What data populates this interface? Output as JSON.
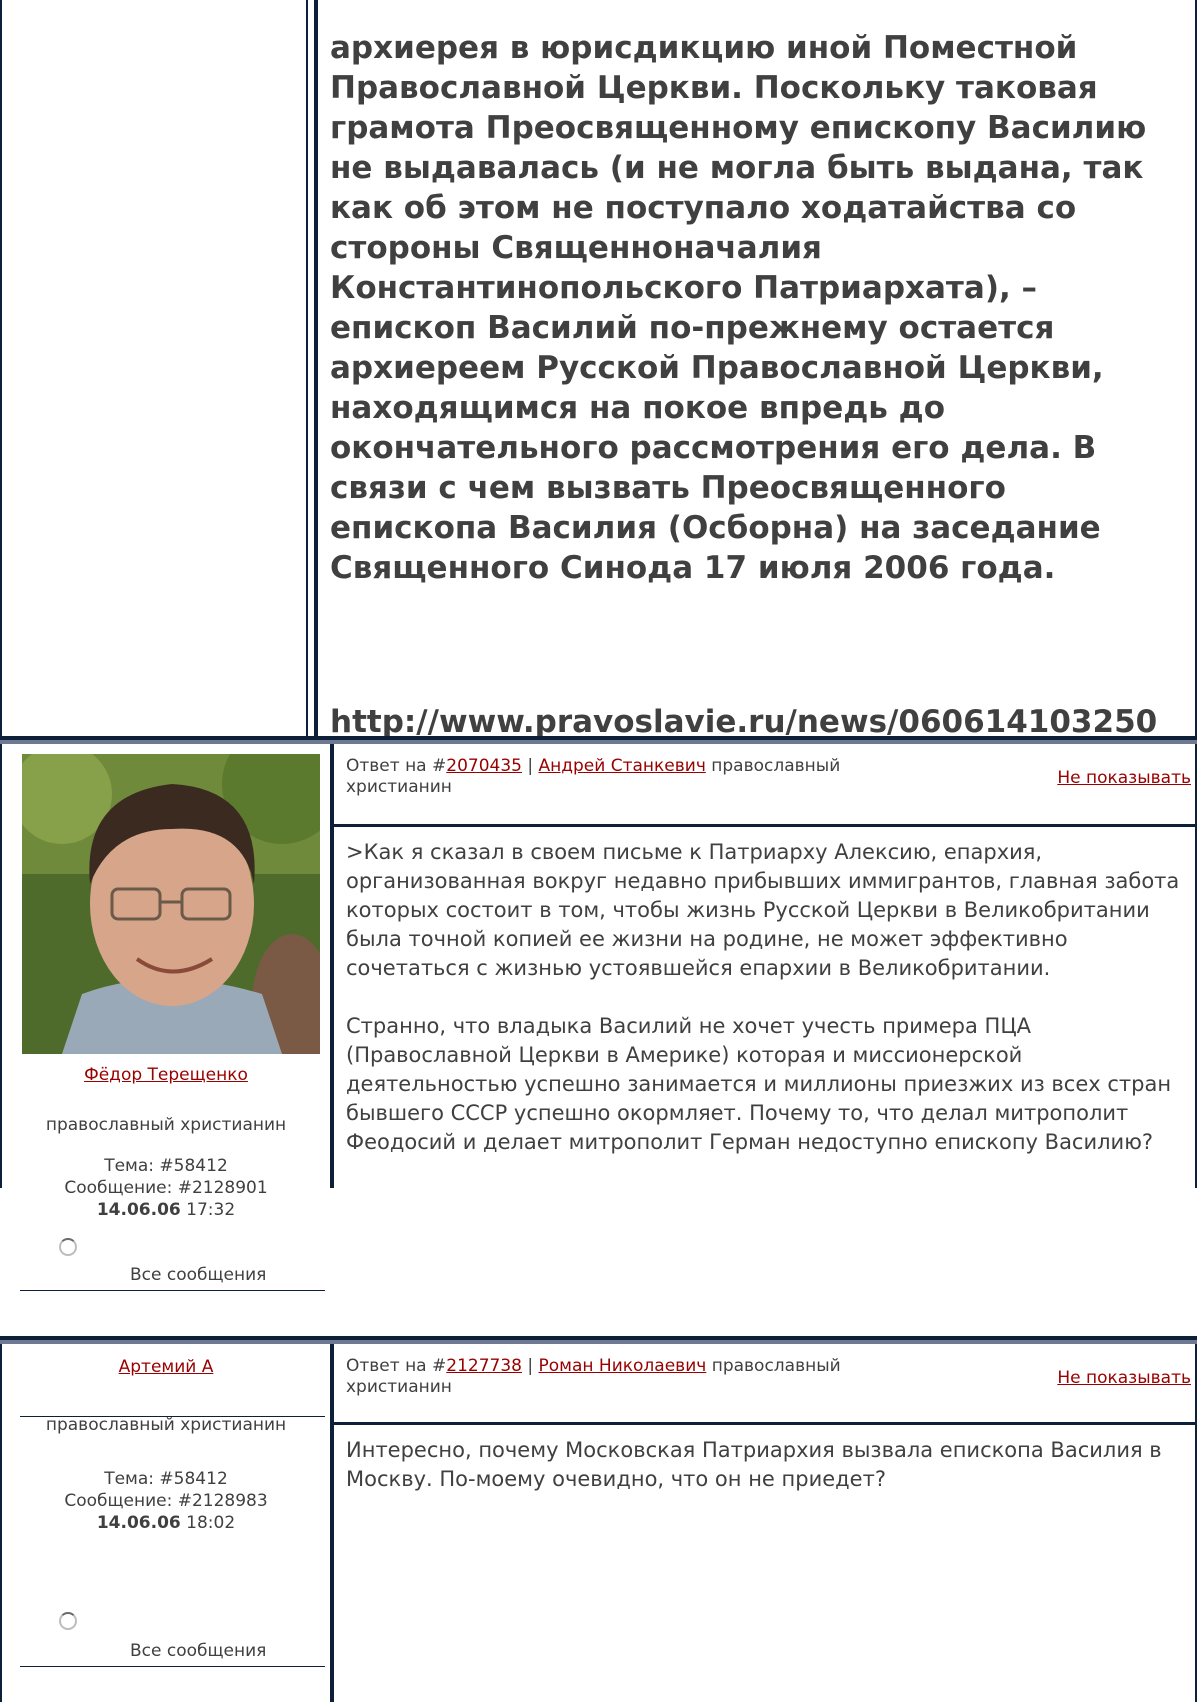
{
  "top_post": {
    "paragraph": "архиерея в юрисдикцию иной Поместной Православной Церкви. Поскольку таковая грамота Преосвященному епископу Василию не выдавалась (и не могла быть выдана, так как об этом не поступало ходатайства со стороны Священноначалия Константинопольского Патриархата), – епископ Василий по-прежнему остается архиереем Русской Православной Церкви, находящимся на покое впредь до окончательного рассмотрения его дела. В связи с чем вызвать Преосвященного епископа Василия (Осборна) на заседание Священного Синода 17 июля 2006 года.",
    "url": "http://www.pravoslavie.ru/news/060614103250"
  },
  "posts": [
    {
      "author_name": "Фёдор Терещенко",
      "author_status": "православный христианин",
      "topic_label": "Тема: #58412",
      "message_label": "Сообщение: #2128901",
      "date": "14.06.06",
      "time": "17:32",
      "all_messages": "Все сообщения",
      "reply_prefix": "Ответ на #",
      "reply_id": "2070435",
      "reply_sep": " | ",
      "reply_author": "Андрей Станкевич",
      "reply_author_status": " православный христианин",
      "hide_label": "Не показывать",
      "body": [
        ">Как я сказал в своем письме к Патриарху Алексию, епархия, организованная вокруг недавно прибывших иммигрантов, главная забота которых состоит в том, чтобы жизнь Русской Церкви в Великобритании была точной копией ее жизни на родине, не может эффективно сочетаться с жизнью устоявшейся епархии в Великобритании.",
        "Странно, что владыка Василий не хочет учесть примера ПЦА (Православной Церкви в Америке) которая и миссионерской деятельностью успешно занимается и миллионы приезжих из всех стран бывшего СССР успешно окормляет. Почему то, что делал митрополит Феодосий и делает митрополит Герман недоступно епископу Василию?"
      ]
    },
    {
      "author_name": "Артемий А",
      "author_status": "православный христианин",
      "topic_label": "Тема: #58412",
      "message_label": "Сообщение: #2128983",
      "date": "14.06.06",
      "time": "18:02",
      "all_messages": "Все сообщения",
      "reply_prefix": "Ответ на #",
      "reply_id": "2127738",
      "reply_sep": " | ",
      "reply_author": "Роман Николаевич",
      "reply_author_status": " православный христианин",
      "hide_label": "Не показывать",
      "body": [
        "Интересно, почему Московская Патриархия вызвала епископа Василия в Москву. По-моему очевидно, что он не приедет?"
      ]
    }
  ],
  "icons": {
    "loading": "spinner-icon",
    "avatar": "avatar-photo"
  },
  "colors": {
    "link": "#990000",
    "text": "#404040",
    "border": "#0e1f3a"
  }
}
